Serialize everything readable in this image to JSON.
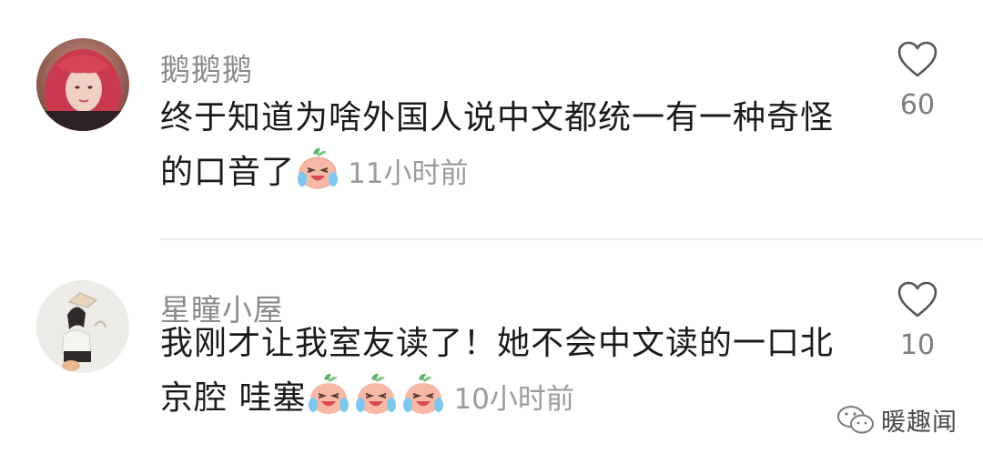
{
  "comments": [
    {
      "username": "鹅鹅鹅",
      "text": "终于知道为啥外国人说中文都统一有一种奇怪的口音了",
      "time": "11小时前",
      "likes": "60"
    },
    {
      "username": "星瞳小屋",
      "text": "我刚才让我室友读了！她不会中文读的一口北京腔 哇塞",
      "time": "10小时前",
      "likes": "10"
    }
  ],
  "watermark": {
    "label": "暖趣闻"
  },
  "icons": {
    "like": "heart-outline-icon",
    "emoji": "crying-laughing-peach-emoji",
    "watermark": "wechat-icon"
  },
  "colors": {
    "username": "#8a8a8a",
    "text": "#1a1a1a",
    "time": "#9b9b9b",
    "like_count": "#7d7d7d"
  }
}
